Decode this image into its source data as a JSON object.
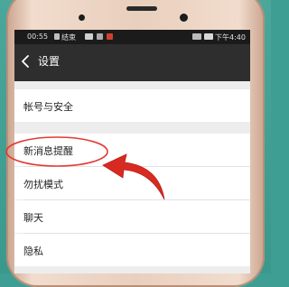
{
  "status_bar": {
    "time": "00:55",
    "app_notice": "结束",
    "signal_icon": "cell-signal-icon",
    "battery_icon": "battery-icon",
    "clock_right": "下午4:40"
  },
  "header": {
    "back_icon": "back-arrow-icon",
    "title": "设置"
  },
  "settings": {
    "items": [
      {
        "label": "帐号与安全"
      },
      {
        "label": "新消息提醒"
      },
      {
        "label": "勿扰模式"
      },
      {
        "label": "聊天"
      },
      {
        "label": "隐私"
      }
    ]
  },
  "annotation": {
    "highlight_color": "#e23b34",
    "arrow_color": "#d92a22"
  }
}
